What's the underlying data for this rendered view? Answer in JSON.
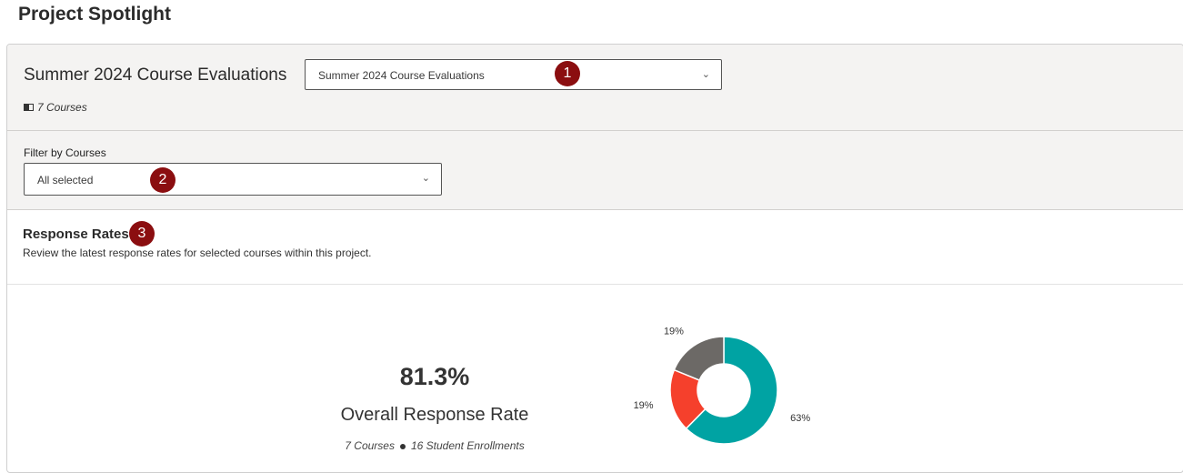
{
  "page": {
    "title": "Project Spotlight"
  },
  "project": {
    "title": "Summer 2024 Course Evaluations",
    "select_value": "Summer 2024 Course Evaluations",
    "course_count": "7 Courses"
  },
  "filter": {
    "label": "Filter by Courses",
    "select_value": "All selected"
  },
  "badges": [
    "1",
    "2",
    "3"
  ],
  "response_rates": {
    "title": "Response Rates",
    "description": "Review the latest response rates for selected courses within this project.",
    "overall_value": "81.3%",
    "overall_label": "Overall Response Rate",
    "courses": "7 Courses",
    "enrollments": "16 Student Enrollments"
  },
  "chart_data": {
    "type": "pie",
    "values": [
      63,
      19,
      19
    ],
    "labels": [
      "63%",
      "19%",
      "19%"
    ],
    "colors": [
      "#00a3a3",
      "#f5402c",
      "#6c6966"
    ]
  },
  "colors": {
    "badge": "#8b0e10",
    "panel_bg": "#f4f3f2"
  }
}
